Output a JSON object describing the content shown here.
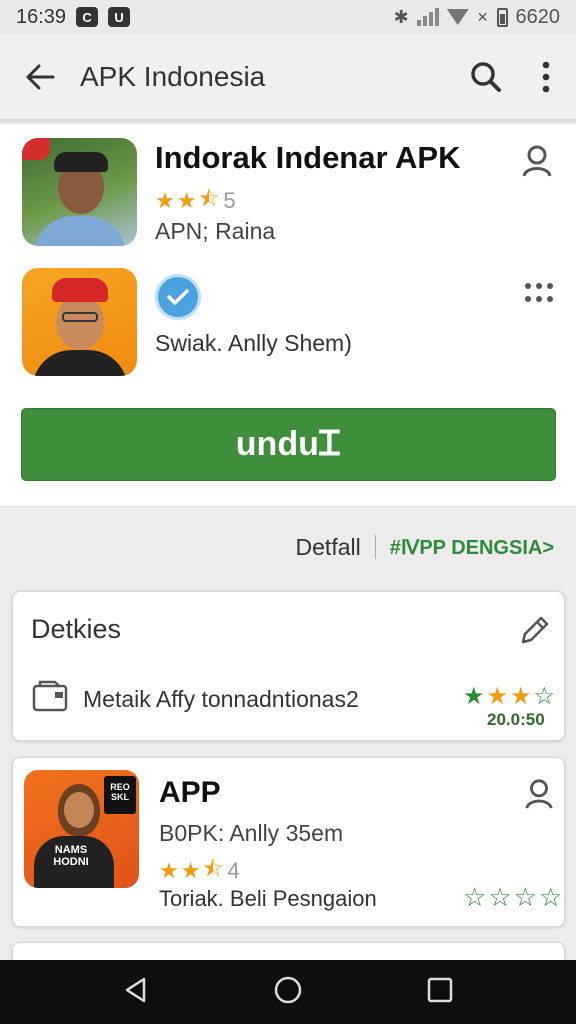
{
  "status_bar": {
    "time": "16:39",
    "badge1": "C",
    "badge2": "U",
    "right_text": "6620"
  },
  "app_bar": {
    "title": "APK Indonesia"
  },
  "app_header": {
    "title": "Indorak Indenar APK",
    "rating": 2.5,
    "rating_count": "5",
    "subtitle": "APN; Raina"
  },
  "developer": {
    "name": "Swiak. Anlly Shem)"
  },
  "download_button": {
    "label": "unduᏆ"
  },
  "tabs": {
    "detail": "Detfall",
    "link": "#ⅣPP DENGSIA>"
  },
  "details_card": {
    "heading": "Detkies",
    "item": "Metaik Affy tonnadntionas2",
    "rating": 3.5,
    "value": "20.0:50"
  },
  "app_card": {
    "title": "APP",
    "subtitle": "B0PK: Anlly 35em",
    "rating": 2.5,
    "rating_count": "4",
    "description": "Toriak. Beli Pesngaion",
    "image_text": "NAMS HODNI",
    "sign_text": "REO SKL",
    "outline_stars": 4
  },
  "colors": {
    "accent_green": "#3e8e3b",
    "star_orange": "#f39c12",
    "verify_blue": "#4aa3df"
  }
}
